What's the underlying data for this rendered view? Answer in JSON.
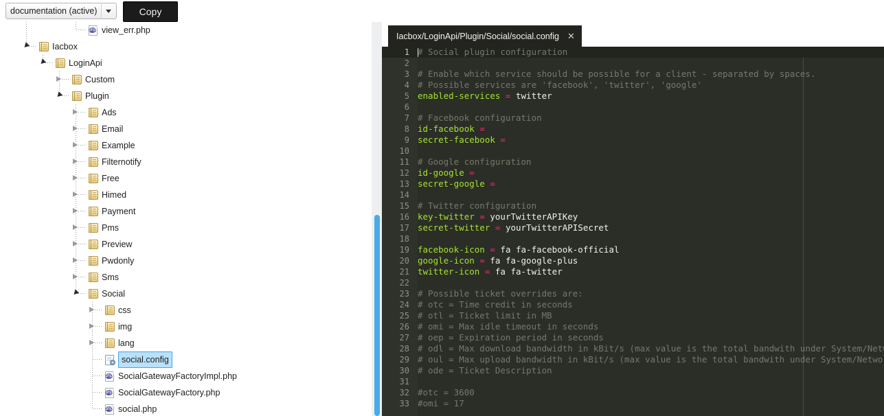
{
  "toolbar": {
    "doc_select_value": "documentation (active)",
    "doc_select_arrow": "chevron-down-icon",
    "copy_label": "Copy"
  },
  "tree": {
    "items": [
      {
        "label": "view_err.php",
        "depth": 3,
        "kind": "php",
        "state": "leaf",
        "selected": false
      },
      {
        "label": "Iacbox",
        "depth": 0,
        "kind": "folder",
        "state": "expanded",
        "selected": false
      },
      {
        "label": "LoginApi",
        "depth": 1,
        "kind": "folder",
        "state": "expanded",
        "selected": false
      },
      {
        "label": "Custom",
        "depth": 2,
        "kind": "folder",
        "state": "collapsed",
        "selected": false
      },
      {
        "label": "Plugin",
        "depth": 2,
        "kind": "folder",
        "state": "expanded",
        "selected": false
      },
      {
        "label": "Ads",
        "depth": 3,
        "kind": "folder",
        "state": "collapsed",
        "selected": false
      },
      {
        "label": "Email",
        "depth": 3,
        "kind": "folder",
        "state": "collapsed",
        "selected": false
      },
      {
        "label": "Example",
        "depth": 3,
        "kind": "folder",
        "state": "collapsed",
        "selected": false
      },
      {
        "label": "Filternotify",
        "depth": 3,
        "kind": "folder",
        "state": "collapsed",
        "selected": false
      },
      {
        "label": "Free",
        "depth": 3,
        "kind": "folder",
        "state": "collapsed",
        "selected": false
      },
      {
        "label": "Himed",
        "depth": 3,
        "kind": "folder",
        "state": "collapsed",
        "selected": false
      },
      {
        "label": "Payment",
        "depth": 3,
        "kind": "folder",
        "state": "collapsed",
        "selected": false
      },
      {
        "label": "Pms",
        "depth": 3,
        "kind": "folder",
        "state": "collapsed",
        "selected": false
      },
      {
        "label": "Preview",
        "depth": 3,
        "kind": "folder",
        "state": "collapsed",
        "selected": false
      },
      {
        "label": "Pwdonly",
        "depth": 3,
        "kind": "folder",
        "state": "collapsed",
        "selected": false
      },
      {
        "label": "Sms",
        "depth": 3,
        "kind": "folder",
        "state": "collapsed",
        "selected": false
      },
      {
        "label": "Social",
        "depth": 3,
        "kind": "folder",
        "state": "expanded",
        "selected": false
      },
      {
        "label": "css",
        "depth": 4,
        "kind": "folder",
        "state": "collapsed",
        "selected": false
      },
      {
        "label": "img",
        "depth": 4,
        "kind": "folder",
        "state": "collapsed",
        "selected": false
      },
      {
        "label": "lang",
        "depth": 4,
        "kind": "folder",
        "state": "collapsed",
        "selected": false
      },
      {
        "label": "social.config",
        "depth": 4,
        "kind": "config",
        "state": "leaf",
        "selected": true
      },
      {
        "label": "SocialGatewayFactoryImpl.php",
        "depth": 4,
        "kind": "php",
        "state": "leaf",
        "selected": false
      },
      {
        "label": "SocialGatewayFactory.php",
        "depth": 4,
        "kind": "php",
        "state": "leaf",
        "selected": false
      },
      {
        "label": "social.php",
        "depth": 4,
        "kind": "php",
        "state": "leaf",
        "selected": false
      }
    ]
  },
  "editor": {
    "tab_title": "Iacbox/LoginApi/Plugin/Social/social.config",
    "tab_close_icon": "close-icon",
    "active_line": 1,
    "lines": [
      {
        "n": 1,
        "parts": [
          {
            "t": "# Social plugin configuration",
            "c": "cm"
          }
        ]
      },
      {
        "n": 2,
        "parts": []
      },
      {
        "n": 3,
        "parts": [
          {
            "t": "# Enable which service should be possible for a client - separated by spaces.",
            "c": "cm"
          }
        ]
      },
      {
        "n": 4,
        "parts": [
          {
            "t": "# Possible services are 'facebook', 'twitter', 'google'",
            "c": "cm"
          }
        ]
      },
      {
        "n": 5,
        "parts": [
          {
            "t": "enabled-services",
            "c": "ck"
          },
          {
            "t": " = ",
            "c": "ceq"
          },
          {
            "t": "twitter",
            "c": "cv"
          }
        ]
      },
      {
        "n": 6,
        "parts": []
      },
      {
        "n": 7,
        "parts": [
          {
            "t": "# Facebook configuration",
            "c": "cm"
          }
        ]
      },
      {
        "n": 8,
        "parts": [
          {
            "t": "id-facebook",
            "c": "ck"
          },
          {
            "t": " =",
            "c": "ceq"
          }
        ]
      },
      {
        "n": 9,
        "parts": [
          {
            "t": "secret-facebook",
            "c": "ck"
          },
          {
            "t": " =",
            "c": "ceq"
          }
        ]
      },
      {
        "n": 10,
        "parts": []
      },
      {
        "n": 11,
        "parts": [
          {
            "t": "# Google configuration",
            "c": "cm"
          }
        ]
      },
      {
        "n": 12,
        "parts": [
          {
            "t": "id-google",
            "c": "ck"
          },
          {
            "t": " =",
            "c": "ceq"
          }
        ]
      },
      {
        "n": 13,
        "parts": [
          {
            "t": "secret-google",
            "c": "ck"
          },
          {
            "t": " =",
            "c": "ceq"
          }
        ]
      },
      {
        "n": 14,
        "parts": []
      },
      {
        "n": 15,
        "parts": [
          {
            "t": "# Twitter configuration",
            "c": "cm"
          }
        ]
      },
      {
        "n": 16,
        "parts": [
          {
            "t": "key-twitter",
            "c": "ck"
          },
          {
            "t": " = ",
            "c": "ceq"
          },
          {
            "t": "yourTwitterAPIKey",
            "c": "cv"
          }
        ]
      },
      {
        "n": 17,
        "parts": [
          {
            "t": "secret-twitter",
            "c": "ck"
          },
          {
            "t": " = ",
            "c": "ceq"
          },
          {
            "t": "yourTwitterAPISecret",
            "c": "cv"
          }
        ]
      },
      {
        "n": 18,
        "parts": []
      },
      {
        "n": 19,
        "parts": [
          {
            "t": "facebook-icon",
            "c": "ck"
          },
          {
            "t": " = ",
            "c": "ceq"
          },
          {
            "t": "fa fa-facebook-official",
            "c": "cv"
          }
        ]
      },
      {
        "n": 20,
        "parts": [
          {
            "t": "google-icon",
            "c": "ck"
          },
          {
            "t": " = ",
            "c": "ceq"
          },
          {
            "t": "fa fa-google-plus",
            "c": "cv"
          }
        ]
      },
      {
        "n": 21,
        "parts": [
          {
            "t": "twitter-icon",
            "c": "ck"
          },
          {
            "t": " = ",
            "c": "ceq"
          },
          {
            "t": "fa fa-twitter",
            "c": "cv"
          }
        ]
      },
      {
        "n": 22,
        "parts": []
      },
      {
        "n": 23,
        "parts": [
          {
            "t": "# Possible ticket overrides are:",
            "c": "cm"
          }
        ]
      },
      {
        "n": 24,
        "parts": [
          {
            "t": "# otc = Time credit in seconds",
            "c": "cm"
          }
        ]
      },
      {
        "n": 25,
        "parts": [
          {
            "t": "# otl = Ticket limit in MB",
            "c": "cm"
          }
        ]
      },
      {
        "n": 26,
        "parts": [
          {
            "t": "# omi = Max idle timeout in seconds",
            "c": "cm"
          }
        ]
      },
      {
        "n": 27,
        "parts": [
          {
            "t": "# oep = Expiration period in seconds",
            "c": "cm"
          }
        ]
      },
      {
        "n": 28,
        "parts": [
          {
            "t": "# odl = Max download bandwidth in kBit/s (max value is the total bandwith under System/Network)",
            "c": "cm"
          }
        ]
      },
      {
        "n": 29,
        "parts": [
          {
            "t": "# oul = Max upload bandwidth in kBit/s (max value is the total bandwith under System/Network)",
            "c": "cm"
          }
        ]
      },
      {
        "n": 30,
        "parts": [
          {
            "t": "# ode = Ticket Description",
            "c": "cm"
          }
        ]
      },
      {
        "n": 31,
        "parts": []
      },
      {
        "n": 32,
        "parts": [
          {
            "t": "#otc = 3600",
            "c": "cm"
          }
        ]
      },
      {
        "n": 33,
        "parts": [
          {
            "t": "#omi = 17",
            "c": "cm"
          }
        ]
      }
    ]
  },
  "colors": {
    "editor_bg": "#2b2e27",
    "gutter_bg": "#2f322b",
    "tab_bg": "#23241f",
    "comment": "#76786b",
    "key": "#a6e22e",
    "operator": "#f92672",
    "value": "#f0f2e4",
    "selection": "#b8e1fb",
    "scrollbar_thumb": "#49abe8"
  }
}
